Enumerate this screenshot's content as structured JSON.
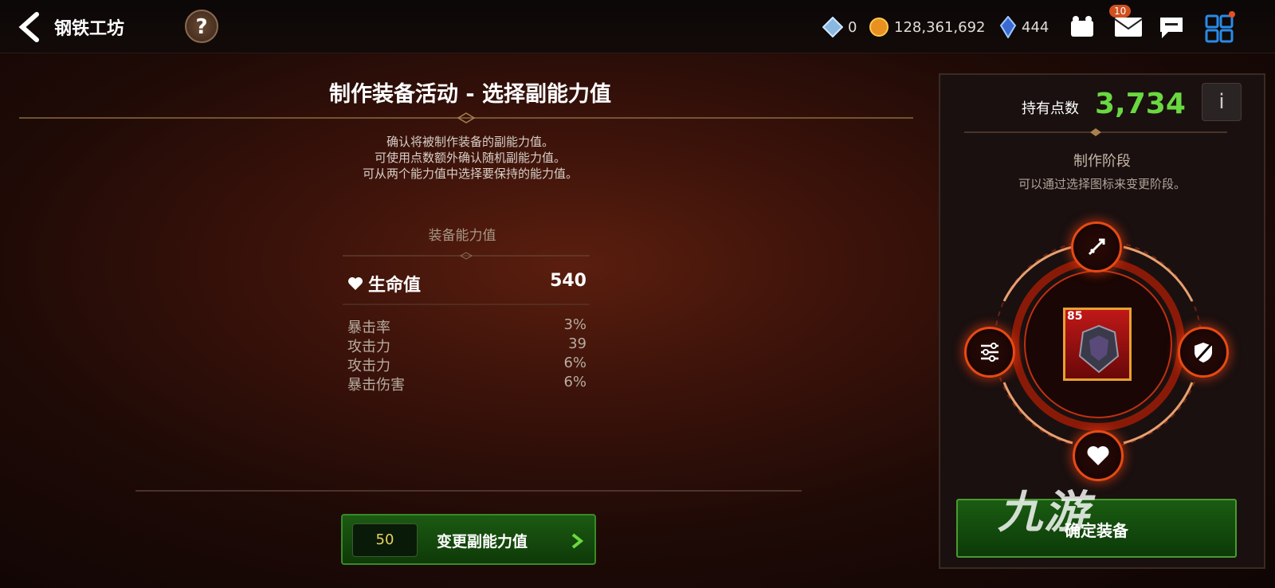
{
  "header": {
    "title": "钢铁工坊",
    "help": "?"
  },
  "currencies": {
    "crystal": "0",
    "gold": "128,361,692",
    "gem": "444",
    "mail_badge": "10"
  },
  "main": {
    "title": "制作装备活动 - 选择副能力值",
    "desc_lines": [
      "确认将被制作装备的副能力值。",
      "可使用点数额外确认随机副能力值。",
      "可从两个能力值中选择要保持的能力值。"
    ],
    "stats_title": "装备能力值",
    "main_stat": {
      "name": "生命值",
      "value": "540"
    },
    "sub_stats": [
      {
        "name": "暴击率",
        "value": "3%"
      },
      {
        "name": "攻击力",
        "value": "39"
      },
      {
        "name": "攻击力",
        "value": "6%"
      },
      {
        "name": "暴击伤害",
        "value": "6%"
      }
    ],
    "change_cost": "50",
    "change_label": "变更副能力值"
  },
  "side": {
    "points_label": "持有点数",
    "points_value": "3,734",
    "info": "i",
    "stage_title": "制作阶段",
    "stage_hint": "可以通过选择图标来变更阶段。",
    "item_level": "85",
    "confirm_label": "确定装备"
  },
  "watermark": "九游",
  "colors": {
    "accent_green": "#6ad840",
    "node_orange": "#e84a14"
  }
}
